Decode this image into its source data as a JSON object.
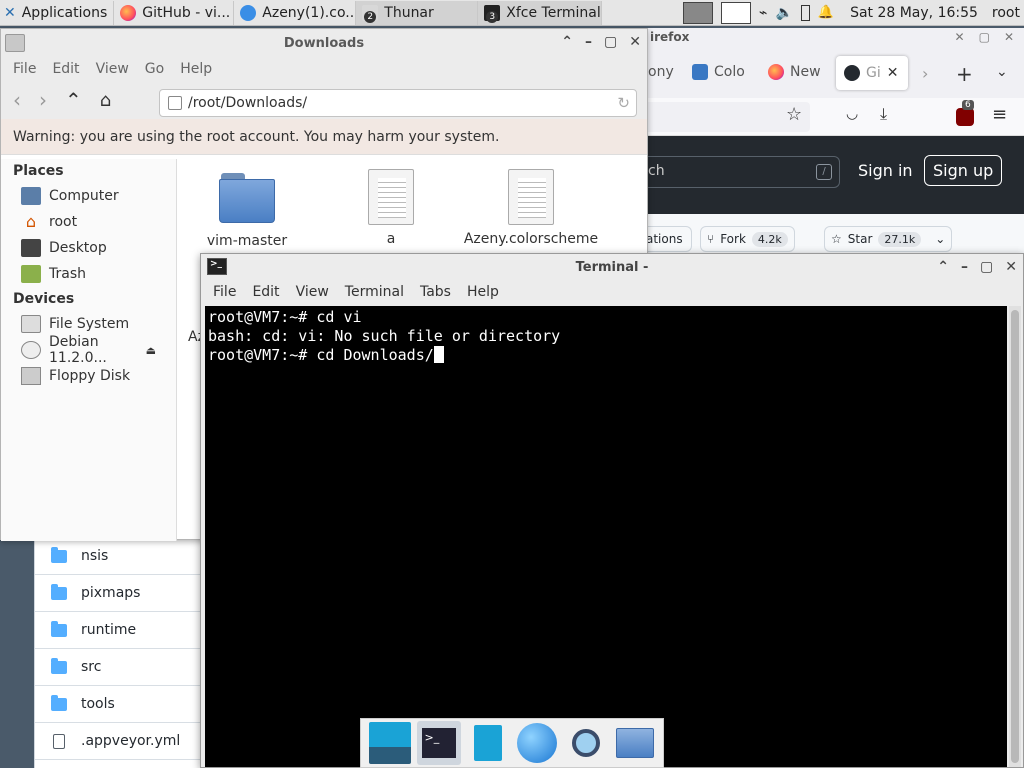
{
  "panel": {
    "apps_label": "Applications",
    "tasks": [
      {
        "label": "GitHub - vi..."
      },
      {
        "label": "Azeny(1).co..."
      },
      {
        "label": "Thunar",
        "badge": "2"
      },
      {
        "label": "Xfce Terminal",
        "badge": "3"
      }
    ],
    "clock": "Sat 28 May, 16:55",
    "user": "root"
  },
  "firefox": {
    "title": "irefox",
    "tabs": [
      "ony",
      "Colo",
      "New",
      "Gi"
    ],
    "search_hint": "ch",
    "sign_in": "Sign in",
    "sign_up": "Sign up",
    "notifications": "ations",
    "fork_label": "Fork",
    "fork_count": "4.2k",
    "star_label": "Star",
    "star_count": "27.1k",
    "addon_badge": "6",
    "files": [
      {
        "name": "nsis"
      },
      {
        "name": "pixmaps"
      },
      {
        "name": "runtime"
      },
      {
        "name": "src"
      },
      {
        "name": "tools"
      },
      {
        "name": ".appveyor.yml"
      }
    ]
  },
  "thunar": {
    "title": "Downloads",
    "menu": [
      "File",
      "Edit",
      "View",
      "Go",
      "Help"
    ],
    "location": "/root/Downloads/",
    "warning": "Warning: you are using the root account. You may harm your system.",
    "places_header": "Places",
    "places": [
      "Computer",
      "root",
      "Desktop",
      "Trash"
    ],
    "devices_header": "Devices",
    "devices": [
      "File System",
      "Debian 11.2.0...",
      "Floppy Disk"
    ],
    "files": [
      "vim-master",
      "a",
      "Azeny.colorscheme"
    ],
    "partial_file": "Az"
  },
  "terminal": {
    "title": "Terminal -",
    "menu": [
      "File",
      "Edit",
      "View",
      "Terminal",
      "Tabs",
      "Help"
    ],
    "lines": [
      "root@VM7:~# cd vi",
      "bash: cd: vi: No such file or directory",
      "root@VM7:~# cd Downloads/"
    ]
  },
  "colors": {
    "github_header": "#24292f",
    "folder_blue": "#54aeff",
    "terminal_bg": "#000000"
  }
}
